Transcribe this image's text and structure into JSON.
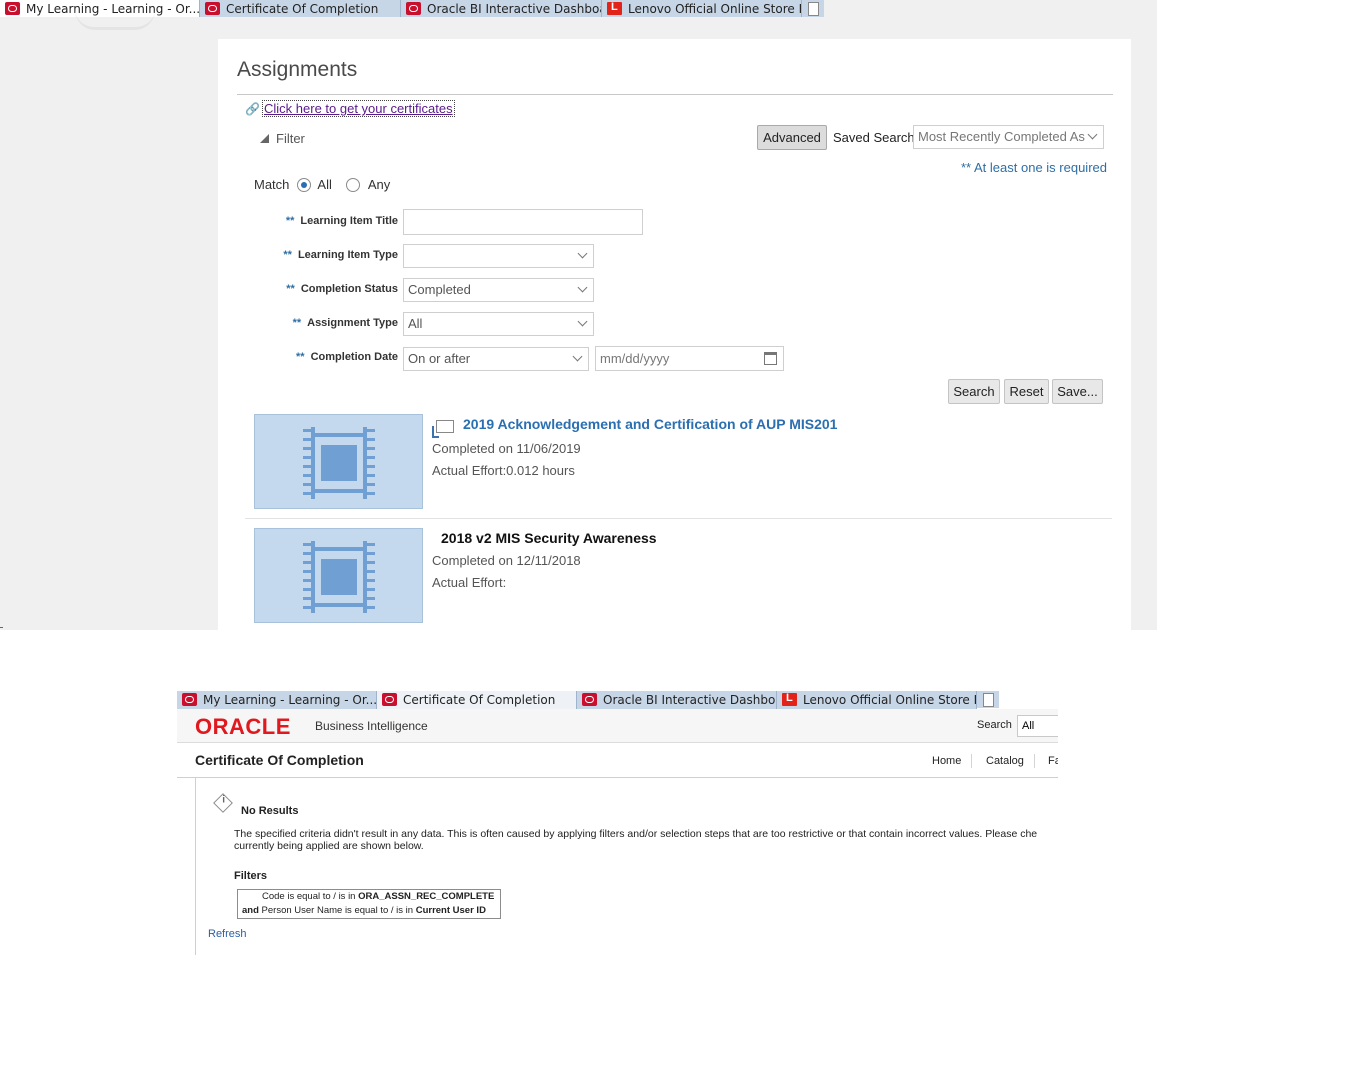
{
  "browser_tabs_top": [
    {
      "label": "My Learning - Learning - Or...",
      "active": true,
      "favicon": "oracle-icon",
      "has_close": true
    },
    {
      "label": "Certificate Of Completion",
      "active": false,
      "favicon": "oracle-icon",
      "has_close": false
    },
    {
      "label": "Oracle BI Interactive Dashboar...",
      "active": false,
      "favicon": "oracle-icon",
      "has_close": false
    },
    {
      "label": "Lenovo Official Online Store In...",
      "active": false,
      "favicon": "lenovo-icon",
      "has_close": false
    }
  ],
  "assignments": {
    "title": "Assignments",
    "cert_link": "Click here to get your certificates",
    "filter_label": "Filter",
    "advanced_button": "Advanced",
    "saved_search_label": "Saved Search",
    "saved_search_value": "Most Recently Completed As",
    "required_note": "** At least one is required",
    "match_label": "Match",
    "match_all": "All",
    "match_any": "Any",
    "fields": {
      "learning_item_title": {
        "label": "Learning Item Title",
        "value": ""
      },
      "learning_item_type": {
        "label": "Learning Item Type",
        "value": ""
      },
      "completion_status": {
        "label": "Completion Status",
        "value": "Completed"
      },
      "assignment_type": {
        "label": "Assignment Type",
        "value": "All"
      },
      "completion_date": {
        "label": "Completion Date",
        "operator": "On or after",
        "placeholder": "mm/dd/yyyy"
      }
    },
    "required_marker": "**",
    "buttons": {
      "search": "Search",
      "reset": "Reset",
      "save": "Save..."
    },
    "items": [
      {
        "title": "2019 Acknowledgement and Certification of AUP MIS201",
        "completed": "Completed on 11/06/2019",
        "effort": "Actual Effort:0.012 hours",
        "title_color": "#2a6fb1"
      },
      {
        "title": "2018 v2 MIS Security Awareness",
        "completed": "Completed on 12/11/2018",
        "effort": "Actual Effort:",
        "title_color": "#111111"
      }
    ]
  },
  "browser_tabs_bottom": [
    {
      "label": "My Learning - Learning - Or...",
      "active": false,
      "favicon": "oracle-icon",
      "has_close": true
    },
    {
      "label": "Certificate Of Completion",
      "active": true,
      "favicon": "oracle-icon",
      "has_close": true
    },
    {
      "label": "Oracle BI Interactive Dashboar...",
      "active": false,
      "favicon": "oracle-icon",
      "has_close": false
    },
    {
      "label": "Lenovo Official Online Store In...",
      "active": false,
      "favicon": "lenovo-icon",
      "has_close": false
    }
  ],
  "obi": {
    "logo": "ORACLE",
    "product": "Business Intelligence",
    "search_label": "Search",
    "search_scope": "All",
    "page_title": "Certificate Of Completion",
    "nav": [
      "Home",
      "Catalog",
      "Fa"
    ],
    "no_results_title": "No Results",
    "no_results_line1": "The specified criteria didn't result in any data. This is often caused by applying filters and/or selection steps that are too restrictive or that contain incorrect values. Please che",
    "no_results_line2": "currently being applied are shown below.",
    "filters_label": "Filters",
    "filter1_prefix": "Code is equal to / is in",
    "filter1_value": "ORA_ASSN_REC_COMPLETE",
    "filter2_and": "and",
    "filter2_prefix": "Person User Name is equal to / is in",
    "filter2_value": "Current User ID",
    "refresh": "Refresh"
  },
  "colors": {
    "oracle_red": "#e0191f",
    "link_blue": "#2a6fb1",
    "required_blue": "#2f6ea4",
    "thumb_blue": "#c4d8ee"
  }
}
